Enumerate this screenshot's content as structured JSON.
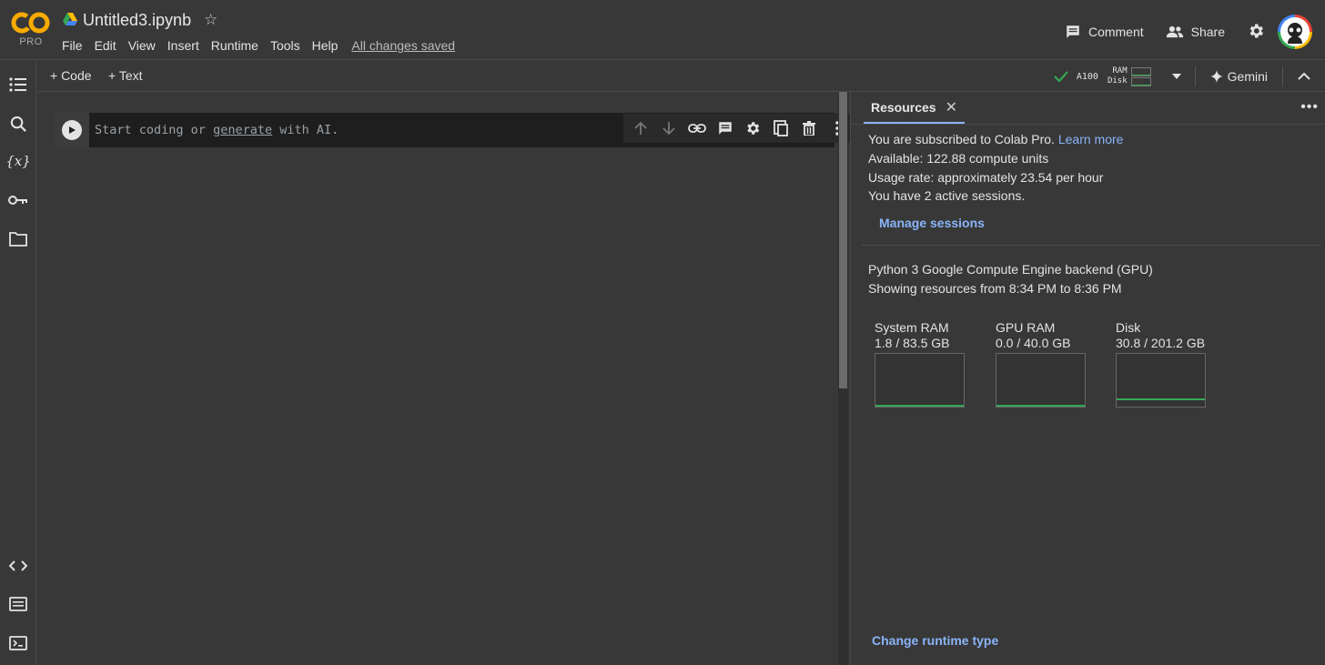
{
  "header": {
    "logo_text": "PRO",
    "title": "Untitled3.ipynb",
    "menu": [
      "File",
      "Edit",
      "View",
      "Insert",
      "Runtime",
      "Tools",
      "Help"
    ],
    "saved_status": "All changes saved",
    "comment_label": "Comment",
    "share_label": "Share"
  },
  "toolbar": {
    "code_label": "+ Code",
    "text_label": "+ Text",
    "gpu_label": "A100",
    "ram_label": "RAM",
    "disk_label": "Disk",
    "gemini_label": "Gemini"
  },
  "cell": {
    "placeholder_prefix": "Start coding or",
    "placeholder_link": "generate",
    "placeholder_suffix": "with AI."
  },
  "panel": {
    "tab_label": "Resources",
    "subscribed_text": "You are subscribed to Colab Pro.",
    "learn_more": "Learn more",
    "available": "Available: 122.88 compute units",
    "usage_rate": "Usage rate: approximately 23.54 per hour",
    "sessions": "You have 2 active sessions.",
    "manage_sessions": "Manage sessions",
    "backend": "Python 3 Google Compute Engine backend (GPU)",
    "showing": "Showing resources from 8:34 PM to 8:36 PM",
    "gauges": [
      {
        "name": "System RAM",
        "value": "1.8 / 83.5 GB",
        "fraction": 0.022
      },
      {
        "name": "GPU RAM",
        "value": "0.0 / 40.0 GB",
        "fraction": 0.0
      },
      {
        "name": "Disk",
        "value": "30.8 / 201.2 GB",
        "fraction": 0.153
      }
    ],
    "change_runtime": "Change runtime type"
  },
  "colors": {
    "accent_link": "#8ab4f8",
    "ok_green": "#34a853",
    "background": "#383838"
  }
}
